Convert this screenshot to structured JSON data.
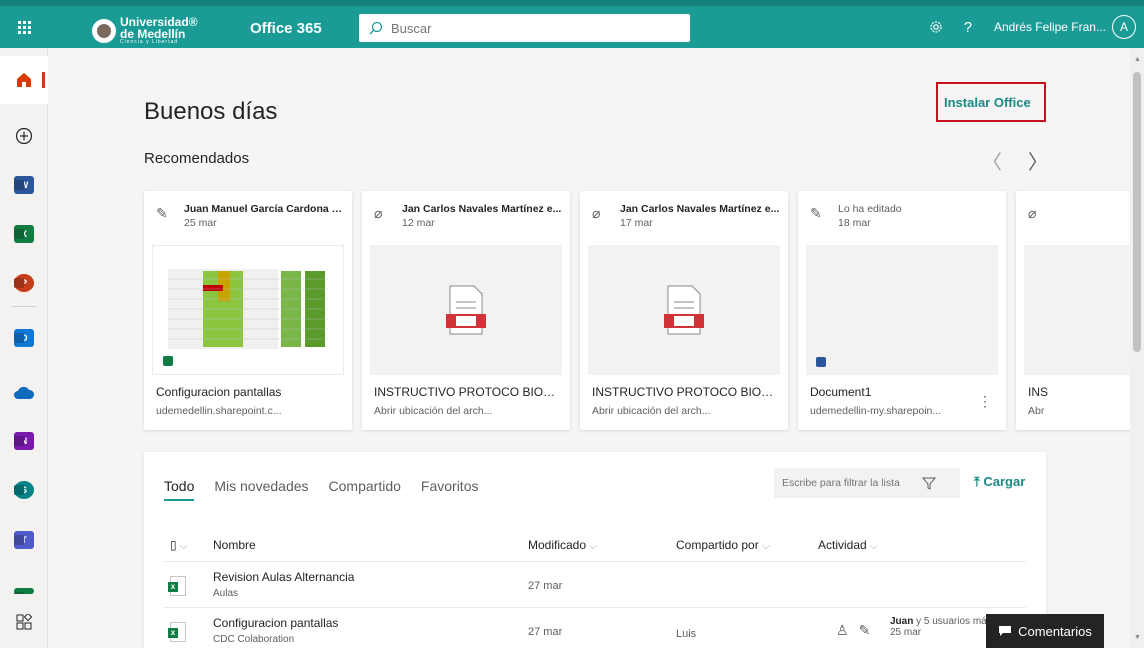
{
  "header": {
    "org_line1": "Universidad®",
    "org_line2": "de Medellín",
    "org_line3": "Ciencia y Libertad",
    "app_name": "Office 365",
    "search_placeholder": "Buscar",
    "help_label": "?",
    "user_name": "Andrés Felipe Fran...",
    "avatar_initial": "A"
  },
  "colors": {
    "brand": "#1b9b96",
    "accent_text": "#1b8a85",
    "highlight_border": "#c50f1f"
  },
  "rail": {
    "items": [
      {
        "name": "home-icon",
        "label": ""
      },
      {
        "name": "create-icon",
        "label": ""
      },
      {
        "name": "word-icon",
        "label": "W"
      },
      {
        "name": "excel-icon",
        "label": "X"
      },
      {
        "name": "powerpoint-icon",
        "label": "P"
      },
      {
        "name": "outlook-icon",
        "label": "O"
      },
      {
        "name": "onedrive-icon",
        "label": ""
      },
      {
        "name": "onenote-icon",
        "label": "N"
      },
      {
        "name": "sharepoint-icon",
        "label": "S"
      },
      {
        "name": "teams-icon",
        "label": "T"
      },
      {
        "name": "all-apps-icon",
        "label": ""
      }
    ]
  },
  "main": {
    "greeting": "Buenos días",
    "install_label": "Instalar Office",
    "recommended_title": "Recomendados",
    "cards": [
      {
        "who": "Juan Manuel García Cardona y...",
        "date": "25 mar",
        "title": "Configuracion pantallas",
        "sub": "udemedellin.sharepoint.c...",
        "type": "excel"
      },
      {
        "who": "Jan Carlos Navales Martínez e...",
        "date": "12 mar",
        "title": "INSTRUCTIVO PROTOCO BIOSEG...",
        "sub": "Abrir ubicación del arch...",
        "type": "pdf"
      },
      {
        "who": "Jan Carlos Navales Martínez e...",
        "date": "17 mar",
        "title": "INSTRUCTIVO PROTOCO BIOSEG...",
        "sub": "Abrir ubicación del arch...",
        "type": "pdf"
      },
      {
        "who": "Lo ha editado",
        "date": "18 mar",
        "title": "Document1",
        "sub": "udemedellin-my.sharepoin...",
        "type": "word"
      },
      {
        "who": "",
        "date": "",
        "title": "INS",
        "sub": "Abr",
        "type": "pdf"
      }
    ]
  },
  "files": {
    "tabs": [
      "Todo",
      "Mis novedades",
      "Compartido",
      "Favoritos"
    ],
    "filter_placeholder": "Escribe para filtrar la lista",
    "upload_label": "Cargar",
    "columns": {
      "name": "Nombre",
      "modified": "Modificado",
      "shared_by": "Compartido por",
      "activity": "Actividad"
    },
    "rows": [
      {
        "name": "Revision Aulas Alternancia",
        "location": "Aulas",
        "modified": "27 mar",
        "shared_by": "",
        "activity_user": "",
        "activity_rest": ""
      },
      {
        "name": "Configuracion pantallas",
        "location": "CDC Colaboration",
        "modified": "27 mar",
        "shared_by": "Luis",
        "activity_user": "Juan",
        "activity_rest": "y 5 usuarios más",
        "activity_date": "25 mar"
      }
    ]
  },
  "feedback_label": "Comentarios"
}
